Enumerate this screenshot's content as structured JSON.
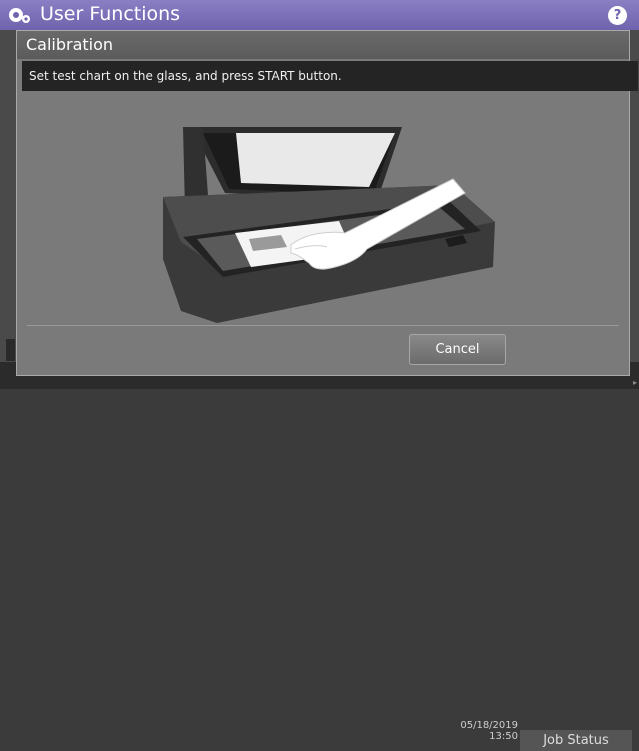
{
  "app": {
    "title": "User Functions",
    "help_label": "?"
  },
  "dialog": {
    "title": "Calibration",
    "message": "Set test chart on the glass, and press START button.",
    "cancel_label": "Cancel"
  },
  "statusbar": {
    "date": "05/18/2019",
    "time": "13:50",
    "job_status_label": "Job Status"
  },
  "colors": {
    "title_bar": "#6f63ad",
    "dialog_bg": "#7a7a7a",
    "message_bar": "#242424"
  },
  "icons": {
    "app": "gear-icon",
    "help": "help-icon",
    "illustration": "scanner-hand-illustration"
  }
}
